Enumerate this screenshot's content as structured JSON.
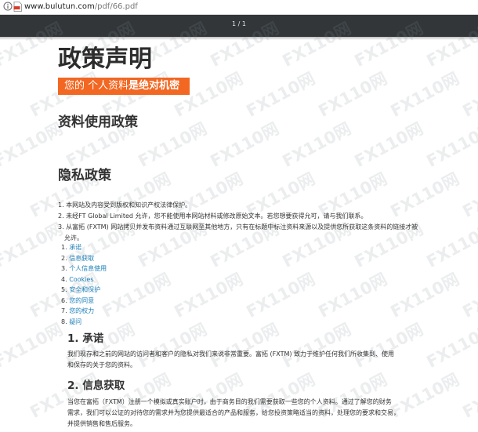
{
  "browser": {
    "url_domain": "www.bulutun.com",
    "url_path": "/pdf/66.pdf"
  },
  "viewer": {
    "page_indicator": "1 / 1"
  },
  "doc": {
    "title": "政策声明",
    "banner_normal": "您的 个人资料",
    "banner_bold": "是绝对机密",
    "section_usage": "资料使用政策",
    "section_privacy": "隐私政策",
    "policy_points": [
      "1. 本网站及内容受到版权和知识产权法律保护。",
      "2. 未经FT Global Limited 允许，您不能使用本网站材料或修改原始文本。若您想要获得允可，请与我们联系。",
      "3. 从富拓 (FXTM) 网站拷贝并发布资料通过互联网至其他地方，只有在标题中标注资料来源以及提供您所获取这条资料的链接才被"
    ],
    "policy_point_continuation": "允许。",
    "toc": [
      {
        "num": "1.",
        "label": "承诺"
      },
      {
        "num": "2.",
        "label": "信息获取"
      },
      {
        "num": "3.",
        "label": "个人信息使用"
      },
      {
        "num": "4.",
        "label": "Cookies"
      },
      {
        "num": "5.",
        "label": "安全和保护"
      },
      {
        "num": "6.",
        "label": "您的同意"
      },
      {
        "num": "7.",
        "label": "您的权力"
      },
      {
        "num": "8.",
        "label": "疑问"
      }
    ],
    "sec1_heading": "1. 承诺",
    "sec1_lines": [
      "我们现存和之前的网站的访问者和客户的隐私对我们来说非常重要。富拓 (FXTM) 致力于维护任何我们所收集到、使用",
      "和保存的关于您的资料。"
    ],
    "sec2_heading": "2. 信息获取",
    "sec2_lines": [
      "当您在富拓（FXTM）注册一个模拟或真实账户时，由于商务目的我们需要获取一些您的个人资料。通过了解您的财务",
      "需求，我们可以公证的对待您的需求并为您提供最适合的产品和服务，给您投资策略适当的资料，处理您的要求和交易，",
      "并提供销售和售后服务。"
    ]
  },
  "watermark": "FX110网",
  "colors": {
    "banner": "#f26722",
    "link": "#1c7fb8",
    "toolbar": "#323639"
  }
}
